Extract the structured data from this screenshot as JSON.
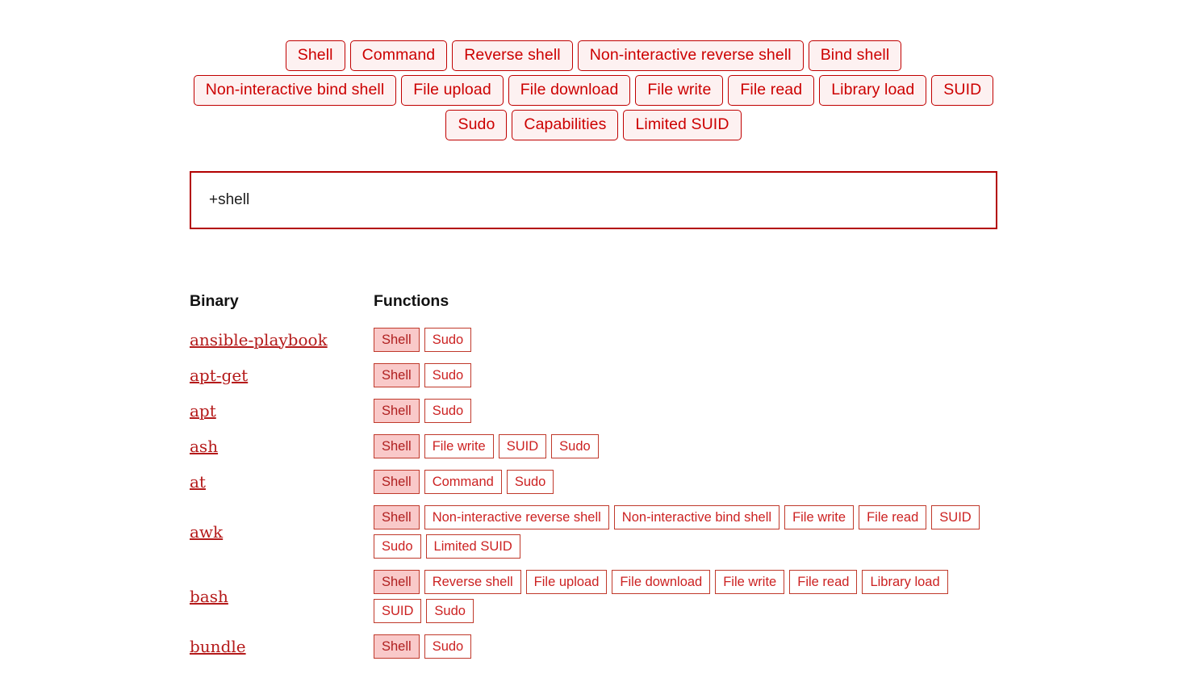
{
  "filters": {
    "tags": [
      "Shell",
      "Command",
      "Reverse shell",
      "Non-interactive reverse shell",
      "Bind shell",
      "Non-interactive bind shell",
      "File upload",
      "File download",
      "File write",
      "File read",
      "Library load",
      "SUID",
      "Sudo",
      "Capabilities",
      "Limited SUID"
    ]
  },
  "search": {
    "value": "+shell",
    "placeholder": ""
  },
  "table": {
    "headers": {
      "binary": "Binary",
      "functions": "Functions"
    },
    "rows": [
      {
        "binary": "ansible-playbook",
        "functions": [
          {
            "label": "Shell",
            "active": true
          },
          {
            "label": "Sudo",
            "active": false
          }
        ]
      },
      {
        "binary": "apt-get",
        "functions": [
          {
            "label": "Shell",
            "active": true
          },
          {
            "label": "Sudo",
            "active": false
          }
        ]
      },
      {
        "binary": "apt",
        "functions": [
          {
            "label": "Shell",
            "active": true
          },
          {
            "label": "Sudo",
            "active": false
          }
        ]
      },
      {
        "binary": "ash",
        "functions": [
          {
            "label": "Shell",
            "active": true
          },
          {
            "label": "File write",
            "active": false
          },
          {
            "label": "SUID",
            "active": false
          },
          {
            "label": "Sudo",
            "active": false
          }
        ]
      },
      {
        "binary": "at",
        "functions": [
          {
            "label": "Shell",
            "active": true
          },
          {
            "label": "Command",
            "active": false
          },
          {
            "label": "Sudo",
            "active": false
          }
        ]
      },
      {
        "binary": "awk",
        "functions": [
          {
            "label": "Shell",
            "active": true
          },
          {
            "label": "Non-interactive reverse shell",
            "active": false
          },
          {
            "label": "Non-interactive bind shell",
            "active": false
          },
          {
            "label": "File write",
            "active": false
          },
          {
            "label": "File read",
            "active": false
          },
          {
            "label": "SUID",
            "active": false
          },
          {
            "label": "Sudo",
            "active": false
          },
          {
            "label": "Limited SUID",
            "active": false
          }
        ]
      },
      {
        "binary": "bash",
        "functions": [
          {
            "label": "Shell",
            "active": true
          },
          {
            "label": "Reverse shell",
            "active": false
          },
          {
            "label": "File upload",
            "active": false
          },
          {
            "label": "File download",
            "active": false
          },
          {
            "label": "File write",
            "active": false
          },
          {
            "label": "File read",
            "active": false
          },
          {
            "label": "Library load",
            "active": false
          },
          {
            "label": "SUID",
            "active": false
          },
          {
            "label": "Sudo",
            "active": false
          }
        ]
      },
      {
        "binary": "bundle",
        "functions": [
          {
            "label": "Shell",
            "active": true
          },
          {
            "label": "Sudo",
            "active": false
          }
        ]
      }
    ]
  },
  "colors": {
    "accent": "#cc0000",
    "border": "#c0392b",
    "tag_bg": "#fdf1f1",
    "badge_active_bg": "#f9c9c9",
    "link": "#b51b1b"
  }
}
